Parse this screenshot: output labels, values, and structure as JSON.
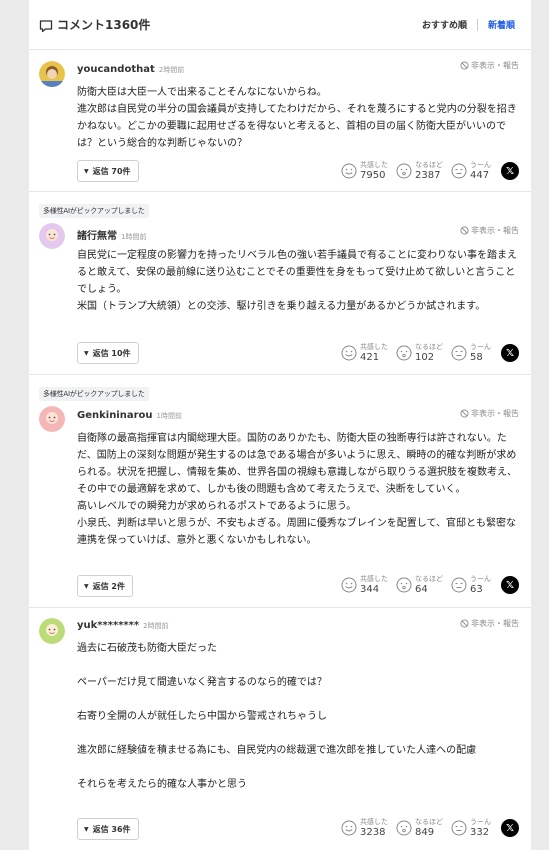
{
  "header": {
    "title": "コメント1360件",
    "sort_recommended": "おすすめ順",
    "sort_newest": "新着順"
  },
  "labels": {
    "report": "非表示・報告",
    "empathize": "共感した",
    "agree": "なるほど",
    "hmm": "うーん",
    "share": "𝕏"
  },
  "comments": [
    {
      "pick": "",
      "user": "youcandothat",
      "time": "2時間前",
      "body": "防衛大臣は大臣一人で出来ることそんなにないからね。\n進次郎は自民党の半分の国会議員が支持してたわけだから、それを蔑ろにすると党内の分裂を招きかねない。どこかの要職に起用せざるを得ないと考えると、首相の目の届く防衛大臣がいいのでは？という総合的な判断じゃないの？",
      "reply": "返信 70件",
      "empathize": "7950",
      "agree": "2387",
      "hmm": "447",
      "avatar_color": "#c9a227"
    },
    {
      "pick": "多様性AIがピックアップしました",
      "user": "諸行無常",
      "time": "1時間前",
      "body": "自民党に一定程度の影響力を持ったリベラル色の強い若手議員で有ることに変わりない事を踏まえると敢えて、安保の最前線に送り込むことでその重要性を身をもって受け止めて欲しいと言うことでしょう。\n米国（トランプ大統領）との交渉、駆け引きを乗り越える力量があるかどうか試されます。",
      "reply": "返信 10件",
      "empathize": "421",
      "agree": "102",
      "hmm": "58",
      "avatar_color": "#d9b8e6"
    },
    {
      "pick": "多様性AIがピックアップしました",
      "user": "Genkininarou",
      "time": "1時間前",
      "body": "自衛隊の最高指揮官は内閣総理大臣。国防のありかたも、防衛大臣の独断専行は許されない。ただ、国防上の深刻な問題が発生するのは急である場合が多いように思え、瞬時の的確な判断が求められる。状況を把握し、情報を集め、世界各国の視線も意識しながら取りうる選択肢を複数考え、その中での最適解を求めて、しかも後の問題も含めて考えたうえで、決断をしていく。\n高いレベルでの瞬発力が求められるポストであるように思う。\n小泉氏、判断は早いと思うが、不安もよぎる。周囲に優秀なブレインを配置して、官邸とも緊密な連携を保っていけば、意外と悪くないかもしれない。",
      "reply": "返信 2件",
      "empathize": "344",
      "agree": "64",
      "hmm": "63",
      "avatar_color": "#f2a9a9"
    },
    {
      "pick": "",
      "user": "yuk********",
      "time": "2時間前",
      "body": "過去に石破茂も防衛大臣だった\n\nペーパーだけ見て間違いなく発言するのなら的確では？\n\n右寄り全開の人が就任したら中国から警戒されちゃうし\n\n進次郎に経験値を積ませる為にも、自民党内の総裁選で進次郎を推していた人達への配慮\n\nそれらを考えたら的確な人事かと思う",
      "reply": "返信 36件",
      "empathize": "3238",
      "agree": "849",
      "hmm": "332",
      "avatar_color": "#b5d86a"
    }
  ]
}
